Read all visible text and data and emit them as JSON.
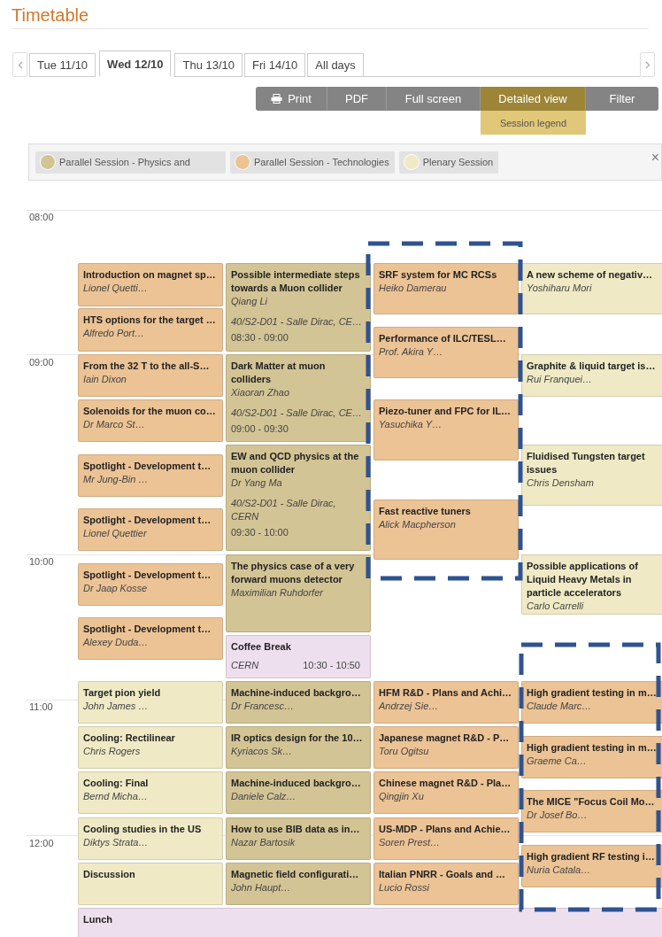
{
  "title": "Timetable",
  "day_tabs": [
    {
      "label": "Tue 11/10",
      "selected": false
    },
    {
      "label": "Wed 12/10",
      "selected": true
    },
    {
      "label": "Thu 13/10",
      "selected": false
    },
    {
      "label": "Fri 14/10",
      "selected": false
    },
    {
      "label": "All days",
      "selected": false
    }
  ],
  "toolbar": [
    {
      "label": "Print",
      "kind": "print",
      "selected": false
    },
    {
      "label": "PDF",
      "kind": "plain",
      "selected": false
    },
    {
      "label": "Full screen",
      "kind": "plain",
      "selected": false
    },
    {
      "label": "Detailed view",
      "kind": "plain",
      "selected": true
    },
    {
      "label": "Filter",
      "kind": "plain",
      "selected": false
    }
  ],
  "session_legend_button": "Session legend",
  "legend": [
    {
      "label": "Parallel Session - Physics and",
      "color": "#d3c495"
    },
    {
      "label": "Parallel Session - Technologies",
      "color": "#ecc395"
    },
    {
      "label": "Plenary Session",
      "color": "#efeac5"
    }
  ],
  "close_symbol": "×",
  "time_labels": [
    "08:00",
    "09:00",
    "10:00",
    "11:00",
    "12:00"
  ],
  "columns": [
    {
      "entries": [
        {
          "kind": "technologies",
          "title": "Introduction on magnet sp…",
          "speaker": "Lionel Quetti…"
        },
        {
          "kind": "technologies",
          "title": "HTS options for the target …",
          "speaker": "Alfredo Port…"
        },
        {
          "kind": "technologies",
          "title": "From the 32 T to the all-S…",
          "speaker": "Iain Dixon"
        },
        {
          "kind": "technologies",
          "title": "Solenoids for the muon co…",
          "speaker": "Dr Marco St…"
        },
        {
          "kind": "technologies",
          "title": "Spotlight - Development t…",
          "speaker": "Mr Jung-Bin …"
        },
        {
          "kind": "technologies",
          "title": "Spotlight - Development t…",
          "speaker": "Lionel Quettier"
        },
        {
          "kind": "technologies",
          "title": "Spotlight - Development t…",
          "speaker": "Dr Jaap Kosse"
        },
        {
          "kind": "technologies",
          "title": "Spotlight - Development t…",
          "speaker": "Alexey Duda…"
        },
        {
          "kind": "plenary",
          "title": "Target pion yield",
          "speaker": "John James …"
        },
        {
          "kind": "plenary",
          "title": "Cooling: Rectilinear",
          "speaker": "Chris Rogers"
        },
        {
          "kind": "plenary",
          "title": "Cooling: Final",
          "speaker": "Bernd Micha…"
        },
        {
          "kind": "plenary",
          "title": "Cooling studies in the US",
          "speaker": "Diktys Strata…"
        },
        {
          "kind": "plenary",
          "title": "Discussion"
        }
      ]
    },
    {
      "entries": [
        {
          "kind": "physics",
          "title": "Possible intermediate steps towards a Muon collider",
          "speaker": "Qiang Li",
          "room": "40/S2-D01 - Salle Dirac, CE…",
          "time": "08:30 - 09:00"
        },
        {
          "kind": "physics",
          "title": "Dark Matter at muon colliders",
          "speaker": "Xiaoran Zhao",
          "room": "40/S2-D01 - Salle Dirac, CE…",
          "time": "09:00 - 09:30"
        },
        {
          "kind": "physics",
          "title": "EW and QCD physics at the muon collider",
          "speaker": "Dr Yang Ma",
          "room": "40/S2-D01 - Salle Dirac, CERN",
          "time": "09:30 - 10:00"
        },
        {
          "kind": "physics",
          "title": "The physics case of a very forward muons detector",
          "speaker": "Maximilian Ruhdorfer"
        },
        {
          "kind": "break",
          "title": "Coffee Break",
          "room": "CERN",
          "time": "10:30 - 10:50"
        },
        {
          "kind": "physics",
          "title": "Machine-induced backgro…",
          "speaker": "Dr Francesc…"
        },
        {
          "kind": "physics",
          "title": "IR optics design for the 10…",
          "speaker": "Kyriacos Sk…"
        },
        {
          "kind": "physics",
          "title": "Machine-induced backgro…",
          "speaker": "Daniele Calz…"
        },
        {
          "kind": "physics",
          "title": "How to use BIB data as in…",
          "speaker": "Nazar Bartosik"
        },
        {
          "kind": "physics",
          "title": "Magnetic field configurati…",
          "speaker": "John Haupt…"
        }
      ]
    },
    {
      "entries": [
        {
          "kind": "technologies",
          "title": "SRF system for MC RCSs",
          "speaker": "Heiko Damerau"
        },
        {
          "kind": "technologies",
          "title": "Performance of ILC/TESL…",
          "speaker": "Prof. Akira Y…"
        },
        {
          "kind": "technologies",
          "title": "Piezo-tuner and FPC for IL…",
          "speaker": "Yasuchika Y…"
        },
        {
          "kind": "technologies",
          "title": "Fast reactive tuners",
          "speaker": "Alick Macpherson"
        },
        {
          "kind": "technologies",
          "title": "HFM R&D - Plans and Achi…",
          "speaker": "Andrzej Sie…"
        },
        {
          "kind": "technologies",
          "title": "Japanese magnet R&D - P…",
          "speaker": "Toru Ogitsu"
        },
        {
          "kind": "technologies",
          "title": "Chinese magnet R&D - Pla…",
          "speaker": "Qingjin Xu"
        },
        {
          "kind": "technologies",
          "title": "US-MDP - Plans and Achie…",
          "speaker": "Soren Prest…"
        },
        {
          "kind": "technologies",
          "title": "Italian PNRR - Goals and …",
          "speaker": "Lucio Rossi"
        }
      ]
    },
    {
      "entries": [
        {
          "kind": "plenary",
          "title": "A new scheme of negativ…",
          "speaker": "Yoshiharu Mori"
        },
        {
          "kind": "plenary",
          "title": "Graphite & liquid target is…",
          "speaker": "Rui Franquei…"
        },
        {
          "kind": "plenary",
          "title": "Fluidised Tungsten target issues",
          "speaker": "Chris Densham"
        },
        {
          "kind": "plenary",
          "title": "Possible applications of Liquid Heavy Metals in particle accelerators",
          "speaker": "Carlo Carrelli"
        },
        {
          "kind": "technologies",
          "title": "High gradient testing in m…",
          "speaker": "Claude Marc…"
        },
        {
          "kind": "technologies",
          "title": "High gradient testing in m…",
          "speaker": "Graeme Ca…"
        },
        {
          "kind": "technologies",
          "title": "The MICE \"Focus Coil Mo…",
          "speaker": "Dr Josef Bo…"
        },
        {
          "kind": "technologies",
          "title": "High gradient RF testing i…",
          "speaker": "Nuria Catala…"
        }
      ]
    }
  ],
  "full_width": [
    {
      "kind": "break",
      "title": "Lunch"
    }
  ]
}
